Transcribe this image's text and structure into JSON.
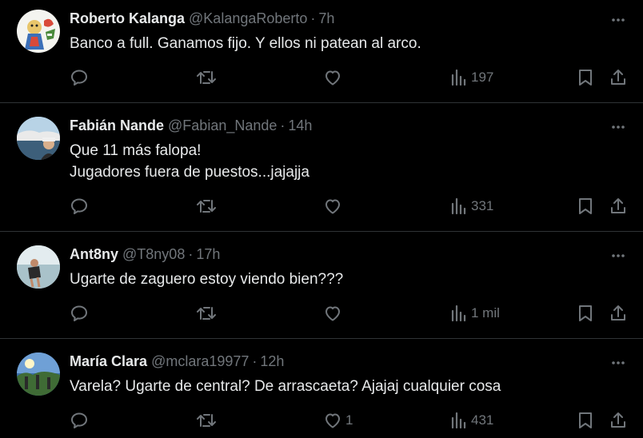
{
  "tweets": [
    {
      "name": "Roberto Kalanga",
      "handle": "@KalangaRoberto",
      "separator": "·",
      "time": "7h",
      "text": "Banco a full. Ganamos fijo. Y ellos ni patean al arco.",
      "likes": "",
      "views": "197",
      "avatar_icon": "cartoon-avatar"
    },
    {
      "name": "Fabián Nande",
      "handle": "@Fabian_Nande",
      "separator": "·",
      "time": "14h",
      "text": "Que 11 más falopa!\nJugadores fuera de puestos...jajajja",
      "likes": "",
      "views": "331",
      "avatar_icon": "landscape-photo-avatar"
    },
    {
      "name": "Ant8ny",
      "handle": "@T8ny08",
      "separator": "·",
      "time": "17h",
      "text": "Ugarte de zaguero estoy viendo bien???",
      "likes": "",
      "views": "1 mil",
      "avatar_icon": "beach-photo-avatar"
    },
    {
      "name": "María Clara",
      "handle": "@mclara19977",
      "separator": "·",
      "time": "12h",
      "text": "Varela? Ugarte de central? De arrascaeta? Ajajaj cualquier cosa",
      "likes": "1",
      "views": "431",
      "avatar_icon": "sky-photo-avatar"
    }
  ],
  "colors": {
    "background": "#000000",
    "text": "#e7e9ea",
    "secondary": "#71767b",
    "divider": "#2f3336"
  }
}
